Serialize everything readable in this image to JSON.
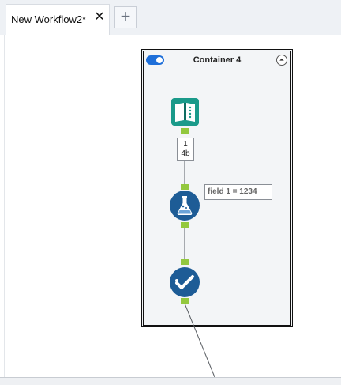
{
  "tabs": [
    {
      "label": "New Workflow2*",
      "close": "✕"
    }
  ],
  "new_tab_label": "+",
  "container": {
    "title": "Container 4",
    "collapse_glyph": "⏶"
  },
  "tools": {
    "input": {
      "icon": "book-icon",
      "color": "#1a9a8a"
    },
    "formula": {
      "icon": "flask-icon",
      "color": "#1d5c96"
    },
    "test": {
      "icon": "checkmark-icon",
      "color": "#1d5c96"
    }
  },
  "record_count": {
    "line1": "1",
    "line2": "4b"
  },
  "annotation": "field 1 = 1234",
  "colors": {
    "anchor": "#93c83e",
    "toggle": "#1e6fd9"
  }
}
